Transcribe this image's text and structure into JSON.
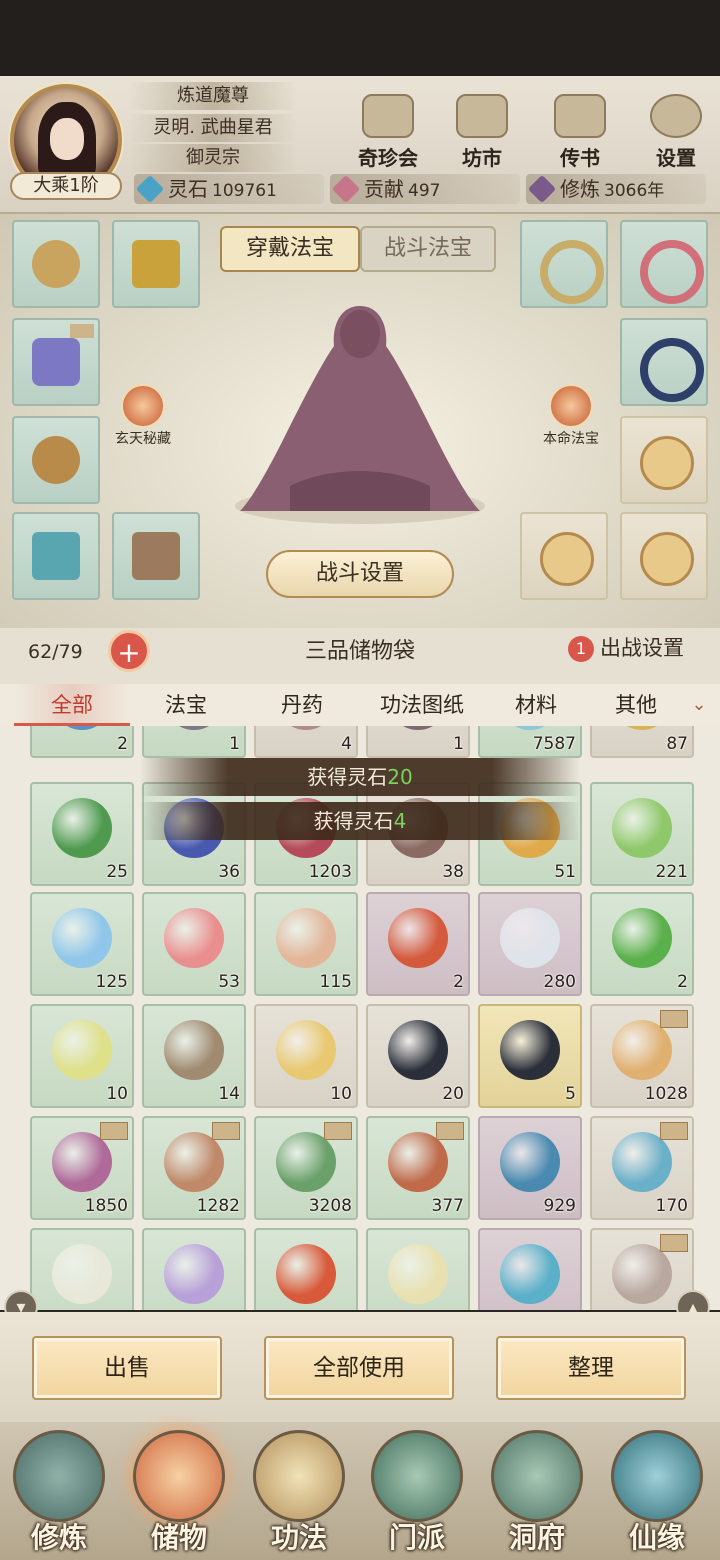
{
  "header": {
    "titles": [
      "炼道魔尊",
      "灵明. 武曲星君",
      "御灵宗"
    ],
    "realm": "大乘1阶",
    "buttons": [
      {
        "label": "奇珍会",
        "icon": "pavilion-icon"
      },
      {
        "label": "坊市",
        "icon": "market-icon"
      },
      {
        "label": "传书",
        "icon": "scroll-letter-icon"
      },
      {
        "label": "设置",
        "icon": "gear-icon"
      }
    ],
    "resources": [
      {
        "label": "灵石",
        "value": "109761",
        "color": "#4aa3c7"
      },
      {
        "label": "贡献",
        "value": "497",
        "color": "#c7758a"
      },
      {
        "label": "修炼",
        "value": "3066年",
        "color": "#7a5a8a"
      }
    ]
  },
  "equipment": {
    "tabs": [
      "穿戴法宝",
      "战斗法宝"
    ],
    "active_tab": "穿戴法宝",
    "left_badge": "玄天秘藏",
    "right_badge": "本命法宝",
    "fight_settings": "战斗设置"
  },
  "bag": {
    "capacity": "62/79",
    "add": "+",
    "title": "三品储物袋",
    "battle_count": "1",
    "battle_label": "出战设置",
    "filters": [
      "全部",
      "法宝",
      "丹药",
      "功法图纸",
      "材料",
      "其他"
    ],
    "active_filter": "全部",
    "more": "⌄"
  },
  "toasts": [
    {
      "text": "获得灵石",
      "amount": "20"
    },
    {
      "text": "获得灵石",
      "amount": "4"
    }
  ],
  "items": [
    [
      "2",
      "1",
      "4",
      "1",
      "7587",
      "87"
    ],
    [
      "25",
      "36",
      "1203",
      "38",
      "51",
      "221"
    ],
    [
      "125",
      "53",
      "115",
      "2",
      "280",
      "2"
    ],
    [
      "10",
      "14",
      "10",
      "20",
      "5",
      "1028"
    ],
    [
      "1850",
      "1282",
      "3208",
      "377",
      "929",
      "170"
    ]
  ],
  "actions": [
    "出售",
    "全部使用",
    "整理"
  ],
  "nav": [
    {
      "label": "修炼",
      "icon": "cultivation-icon"
    },
    {
      "label": "储物",
      "icon": "storage-bag-icon"
    },
    {
      "label": "功法",
      "icon": "technique-scroll-icon"
    },
    {
      "label": "门派",
      "icon": "sect-gate-icon"
    },
    {
      "label": "洞府",
      "icon": "cave-dwelling-icon"
    },
    {
      "label": "仙缘",
      "icon": "fate-swirl-icon"
    }
  ],
  "active_nav": "储物"
}
